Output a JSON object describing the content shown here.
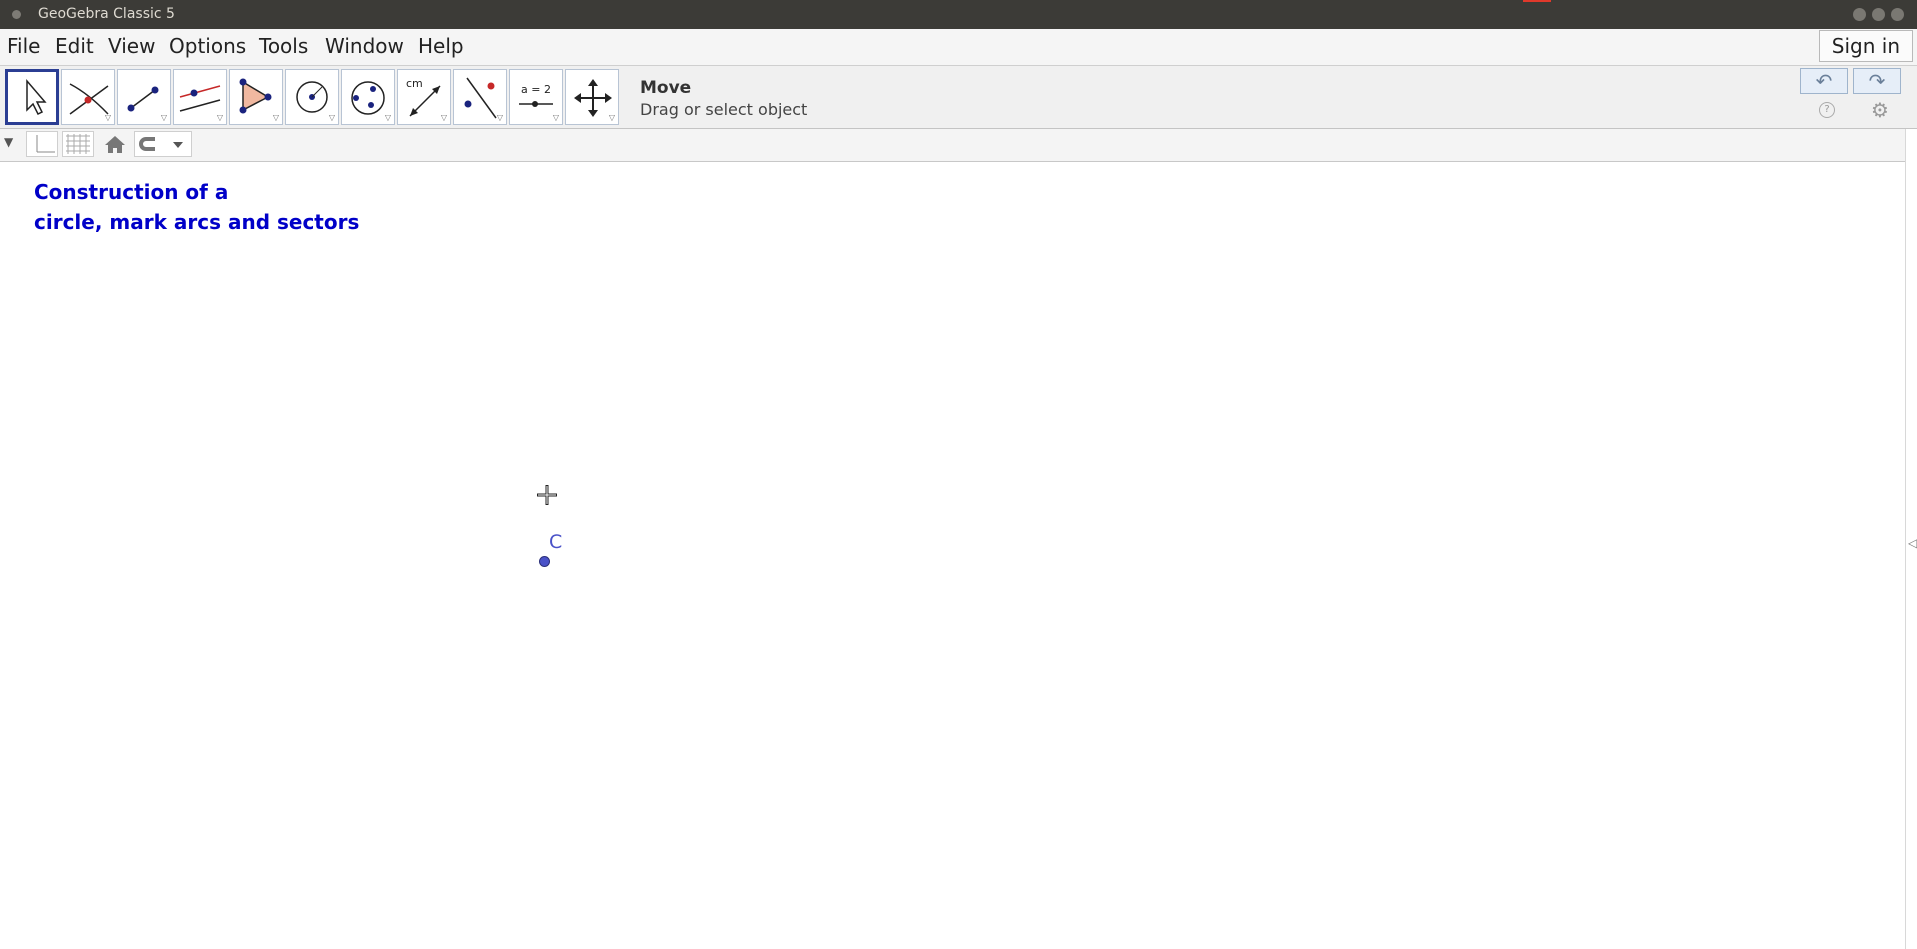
{
  "window": {
    "title": "GeoGebra Classic 5"
  },
  "menubar": {
    "items": [
      "File",
      "Edit",
      "View",
      "Options",
      "Tools",
      "Window",
      "Help"
    ],
    "sign_in": "Sign in"
  },
  "toolbar": {
    "tools": [
      {
        "icon": "move-arrow-icon",
        "selected": true
      },
      {
        "icon": "intersect-point-icon"
      },
      {
        "icon": "segment-icon"
      },
      {
        "icon": "parallel-line-icon"
      },
      {
        "icon": "polygon-icon"
      },
      {
        "icon": "circle-center-point-icon"
      },
      {
        "icon": "circle-three-points-icon"
      },
      {
        "icon": "distance-measure-icon",
        "text": "cm"
      },
      {
        "icon": "reflect-line-icon"
      },
      {
        "icon": "slider-icon",
        "text": "a = 2"
      },
      {
        "icon": "move-graphics-view-icon"
      }
    ],
    "active_tool_name": "Move",
    "active_tool_hint": "Drag or select object"
  },
  "graphics": {
    "caption_line1": "Construction of a",
    "caption_line2": "circle, mark arcs and sectors",
    "point_label": "C",
    "colors": {
      "caption": "#0000c8",
      "point": "#4a52c8"
    }
  }
}
